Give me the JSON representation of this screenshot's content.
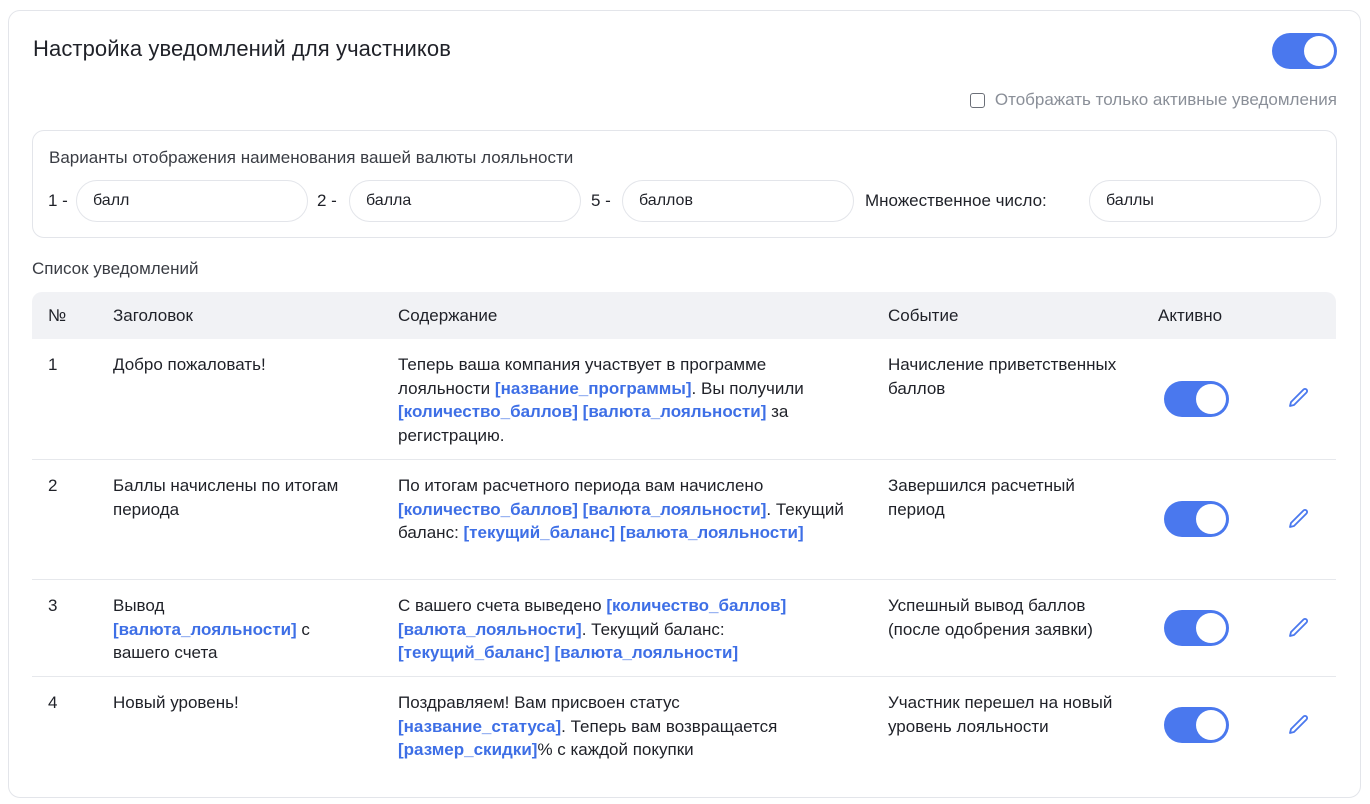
{
  "header": {
    "title": "Настройка уведомлений для участников",
    "enabled": true
  },
  "filter": {
    "label": "Отображать только активные уведомления",
    "checked": false
  },
  "currency": {
    "title": "Варианты отображения наименования вашей валюты лояльности",
    "one_label": "1 -",
    "one_value": "балл",
    "two_label": "2 -",
    "two_value": "балла",
    "five_label": "5 -",
    "five_value": "баллов",
    "plural_label": "Множественное число:",
    "plural_value": "баллы"
  },
  "list": {
    "title": "Список уведомлений",
    "columns": {
      "num": "№",
      "title": "Заголовок",
      "content": "Содержание",
      "event": "Событие",
      "active": "Активно"
    },
    "rows": [
      {
        "num": "1",
        "title": "Добро пожаловать!",
        "content_html": "Теперь ваша компания участвует в программе лояльности <span class=\"var\">[название_программы]</span>. Вы получили <span class=\"var\">[количество_баллов]</span> <span class=\"var\">[валюта_лояльности]</span> за регистрацию.",
        "event": "Начисление приветственных баллов",
        "active": true
      },
      {
        "num": "2",
        "title": "Баллы начислены по итогам периода",
        "content_html": "По итогам расчетного периода вам начислено <span class=\"var\">[количество_баллов]</span> <span class=\"var\">[валюта_лояльности]</span>. Текущий баланс: <span class=\"var\">[текущий_баланс]</span> <span class=\"var\">[валюта_лояльности]</span>",
        "event": "Завершился расчетный период",
        "active": true
      },
      {
        "num": "3",
        "title_html": "Вывод <span class=\"var\">[валюта_лояльности]</span> с вашего счета",
        "content_html": "С вашего счета выведено <span class=\"var\">[количество_баллов]</span> <span class=\"var\">[валюта_лояльности]</span>. Текущий баланс: <span class=\"var\">[текущий_баланс]</span> <span class=\"var\">[валюта_лояльности]</span>",
        "event": "Успешный вывод баллов (после одобрения заявки)",
        "active": true
      },
      {
        "num": "4",
        "title": "Новый уровень!",
        "content_html": "Поздравляем! Вам присвоен статус <span class=\"var\">[название_статуса]</span>. Теперь вам возвращается <span class=\"var\">[размер_скидки]</span>% с каждой покупки",
        "event": "Участник перешел на новый уровень лояльности",
        "active": true
      }
    ]
  },
  "colors": {
    "accent": "#4a78ee",
    "variable_text": "#3e6fe6",
    "header_bg": "#f1f2f5"
  },
  "icons": {
    "edit": "pencil-icon"
  }
}
